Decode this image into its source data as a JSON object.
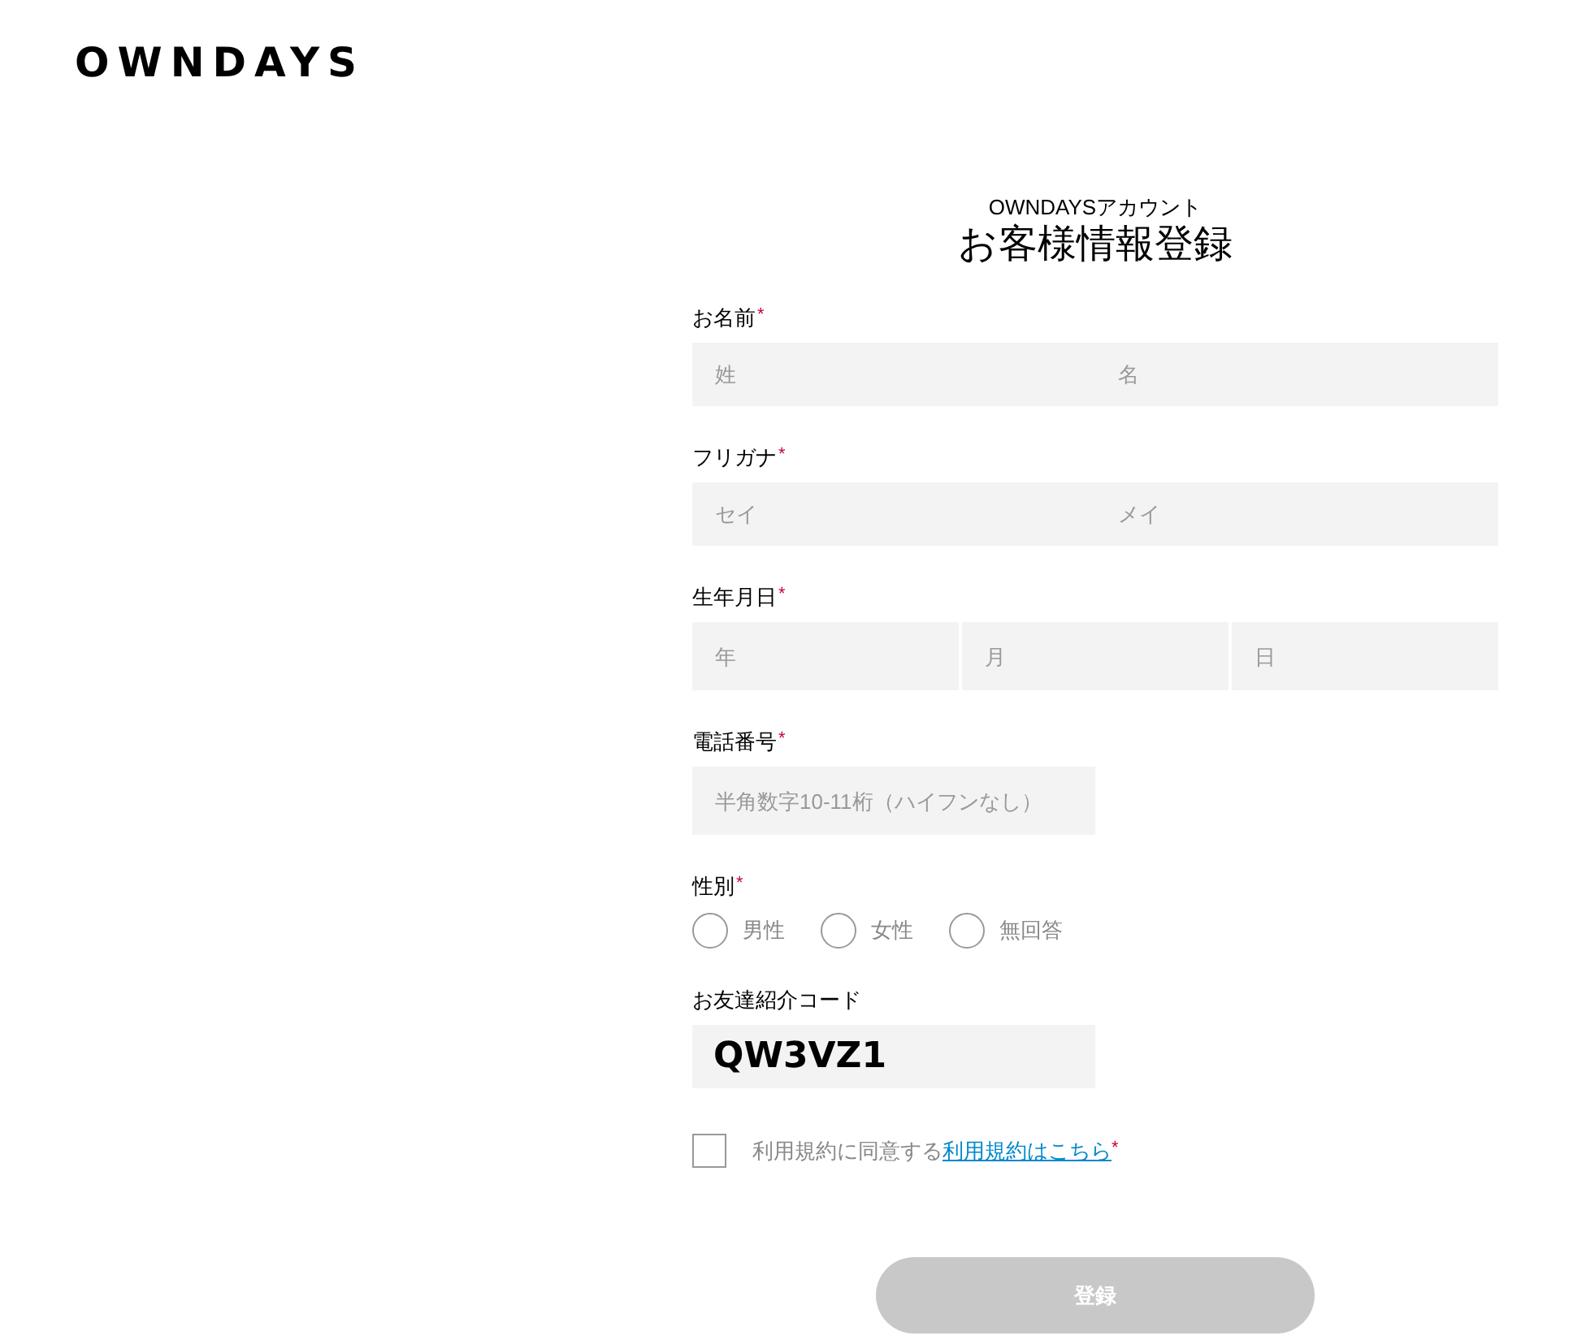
{
  "logo": "OWNDAYS",
  "header": {
    "subtitle": "OWNDAYSアカウント",
    "title": "お客様情報登録"
  },
  "fields": [
    {
      "kind": "inputs",
      "label": "お名前",
      "required_mark": "*",
      "inputs": [
        {
          "placeholder": "姓"
        },
        {
          "placeholder": "名"
        }
      ]
    },
    {
      "kind": "inputs",
      "label": "フリガナ",
      "required_mark": "*",
      "inputs": [
        {
          "placeholder": "セイ"
        },
        {
          "placeholder": "メイ"
        }
      ]
    },
    {
      "kind": "inputs",
      "label": "生年月日",
      "required_mark": "*",
      "inputs": [
        {
          "placeholder": "年"
        },
        {
          "placeholder": "月"
        },
        {
          "placeholder": "日"
        }
      ]
    },
    {
      "kind": "inputs",
      "label": "電話番号",
      "required_mark": "*",
      "inputs": [
        {
          "placeholder": "半角数字10-11桁（ハイフンなし）"
        }
      ]
    },
    {
      "kind": "radio",
      "label": "性別",
      "required_mark": "*",
      "options": [
        {
          "label": "男性",
          "selected": false
        },
        {
          "label": "女性",
          "selected": false
        },
        {
          "label": "無回答",
          "selected": false
        }
      ]
    },
    {
      "kind": "inputs",
      "label": "お友達紹介コード",
      "inputs": [
        {
          "value": "QW3VZ1"
        }
      ]
    }
  ],
  "terms": {
    "checked": false,
    "text": "利用規約に同意する",
    "link": "利用規約はこちら",
    "required_mark": "*"
  },
  "submit": {
    "label": "登録",
    "disabled": true
  }
}
